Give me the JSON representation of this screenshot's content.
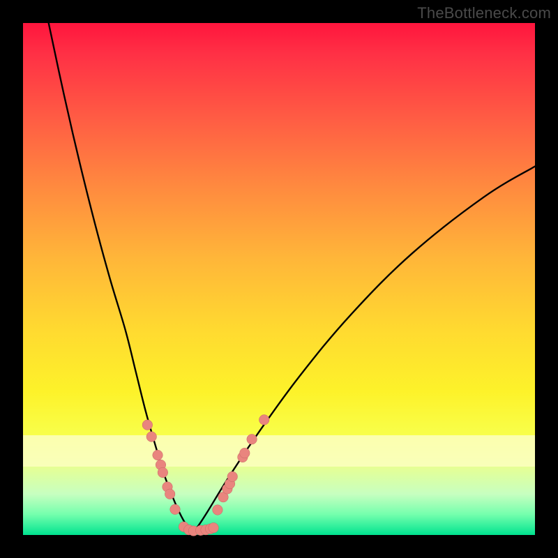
{
  "watermark": {
    "text": "TheBottleneck.com"
  },
  "colors": {
    "background": "#000000",
    "curve": "#000000",
    "marker_fill": "#e9857e",
    "marker_stroke": "#c56763",
    "gradient_top": "#ff153d",
    "gradient_bottom": "#00e38f",
    "highlight_band": "#fbffc0"
  },
  "chart_data": {
    "type": "line",
    "title": "",
    "xlabel": "",
    "ylabel": "",
    "xlim": [
      0,
      100
    ],
    "ylim": [
      0,
      100
    ],
    "grid": false,
    "legend": false,
    "notes": "Axes are unlabeled; values are read as percentages of the plot rectangle. y=0 is the bottom (green), y=100 is the top (red). The black curve is a V shape with minimum near x≈33. Pink markers sit near the bottom of both legs and along the floor.",
    "series": [
      {
        "name": "bottleneck-curve",
        "x": [
          5,
          8,
          11,
          14,
          17,
          20,
          22,
          24,
          26,
          27.5,
          29,
          30.5,
          32,
          33,
          34,
          36,
          40,
          46,
          54,
          64,
          76,
          90,
          100
        ],
        "y": [
          100,
          86,
          73,
          61,
          50,
          40,
          32,
          24,
          17,
          12,
          8,
          4.5,
          1.8,
          0.8,
          1.5,
          4.5,
          11,
          20,
          31,
          43,
          55,
          66,
          72
        ]
      }
    ],
    "markers": {
      "name": "highlighted-points",
      "points": [
        {
          "x": 24.3,
          "y": 21.5
        },
        {
          "x": 25.1,
          "y": 19.2
        },
        {
          "x": 26.3,
          "y": 15.6
        },
        {
          "x": 26.9,
          "y": 13.7
        },
        {
          "x": 27.3,
          "y": 12.2
        },
        {
          "x": 28.2,
          "y": 9.4
        },
        {
          "x": 28.7,
          "y": 8.0
        },
        {
          "x": 29.7,
          "y": 5.0
        },
        {
          "x": 31.4,
          "y": 1.6
        },
        {
          "x": 32.4,
          "y": 1.0
        },
        {
          "x": 33.3,
          "y": 0.8
        },
        {
          "x": 34.7,
          "y": 0.9
        },
        {
          "x": 35.7,
          "y": 1.0
        },
        {
          "x": 36.6,
          "y": 1.2
        },
        {
          "x": 37.2,
          "y": 1.4
        },
        {
          "x": 38.0,
          "y": 4.9
        },
        {
          "x": 39.1,
          "y": 7.4
        },
        {
          "x": 39.9,
          "y": 9.0
        },
        {
          "x": 40.4,
          "y": 10.0
        },
        {
          "x": 40.9,
          "y": 11.4
        },
        {
          "x": 42.9,
          "y": 15.2
        },
        {
          "x": 43.3,
          "y": 16.0
        },
        {
          "x": 44.7,
          "y": 18.7
        },
        {
          "x": 47.1,
          "y": 22.5
        }
      ]
    }
  }
}
